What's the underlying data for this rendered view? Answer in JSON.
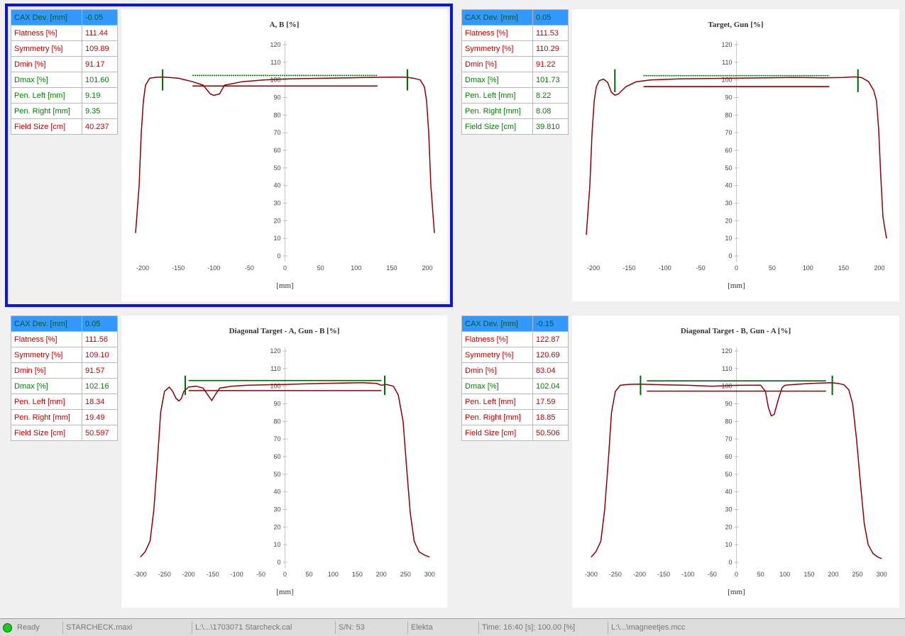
{
  "panels": [
    {
      "id": "ab",
      "selected": true,
      "stats": [
        {
          "label": "CAX Dev. [mm]",
          "value": "-0.05",
          "color": "green"
        },
        {
          "label": "Flatness [%]",
          "value": "111.44",
          "color": "red"
        },
        {
          "label": "Symmetry [%]",
          "value": "109.89",
          "color": "red"
        },
        {
          "label": "Dmin [%]",
          "value": "91.17",
          "color": "red"
        },
        {
          "label": "Dmax [%]",
          "value": "101.60",
          "color": "green"
        },
        {
          "label": "Pen. Left [mm]",
          "value": "9.19",
          "color": "green"
        },
        {
          "label": "Pen. Right [mm]",
          "value": "9.35",
          "color": "green"
        },
        {
          "label": "Field Size [cm]",
          "value": "40.237",
          "color": "red"
        }
      ]
    },
    {
      "id": "target",
      "selected": false,
      "stats": [
        {
          "label": "CAX Dev. [mm]",
          "value": "0.05",
          "color": "green"
        },
        {
          "label": "Flatness [%]",
          "value": "111.53",
          "color": "red"
        },
        {
          "label": "Symmetry [%]",
          "value": "110.29",
          "color": "red"
        },
        {
          "label": "Dmin [%]",
          "value": "91.22",
          "color": "red"
        },
        {
          "label": "Dmax [%]",
          "value": "101.73",
          "color": "green"
        },
        {
          "label": "Pen. Left [mm]",
          "value": "8.22",
          "color": "green"
        },
        {
          "label": "Pen. Right [mm]",
          "value": "8.08",
          "color": "green"
        },
        {
          "label": "Field Size [cm]",
          "value": "39.810",
          "color": "green"
        }
      ]
    },
    {
      "id": "diag1",
      "selected": false,
      "stats": [
        {
          "label": "CAX Dev. [mm]",
          "value": "0.05",
          "color": "green"
        },
        {
          "label": "Flatness [%]",
          "value": "111.56",
          "color": "red"
        },
        {
          "label": "Symmetry [%]",
          "value": "109.10",
          "color": "red"
        },
        {
          "label": "Dmin [%]",
          "value": "91.57",
          "color": "red"
        },
        {
          "label": "Dmax [%]",
          "value": "102.16",
          "color": "green"
        },
        {
          "label": "Pen. Left [mm]",
          "value": "18.34",
          "color": "red"
        },
        {
          "label": "Pen. Right [mm]",
          "value": "19.49",
          "color": "red"
        },
        {
          "label": "Field Size [cm]",
          "value": "50.597",
          "color": "red"
        }
      ]
    },
    {
      "id": "diag2",
      "selected": false,
      "stats": [
        {
          "label": "CAX Dev. [mm]",
          "value": "-0.15",
          "color": "green"
        },
        {
          "label": "Flatness [%]",
          "value": "122.87",
          "color": "red"
        },
        {
          "label": "Symmetry [%]",
          "value": "120.69",
          "color": "red"
        },
        {
          "label": "Dmin [%]",
          "value": "83.04",
          "color": "red"
        },
        {
          "label": "Dmax [%]",
          "value": "102.04",
          "color": "green"
        },
        {
          "label": "Pen. Left [mm]",
          "value": "17.59",
          "color": "red"
        },
        {
          "label": "Pen. Right [mm]",
          "value": "18.85",
          "color": "red"
        },
        {
          "label": "Field Size [cm]",
          "value": "50.506",
          "color": "red"
        }
      ]
    }
  ],
  "chart_data": [
    {
      "type": "line",
      "title": "A, B [%]",
      "xlabel": "[mm]",
      "xlim": [
        -210,
        210
      ],
      "ylim": [
        0,
        120
      ],
      "xticks": [
        "-200",
        "-150",
        "-100",
        "-50",
        "0",
        "50",
        "100",
        "150",
        "200"
      ],
      "yticks": [
        "0",
        "10",
        "20",
        "30",
        "40",
        "50",
        "60",
        "70",
        "80",
        "90",
        "100",
        "110",
        "120"
      ],
      "profile": {
        "x": [
          -210,
          -205,
          -202,
          -199,
          -196,
          -190,
          -180,
          -170,
          -150,
          -130,
          -115,
          -105,
          -100,
          -92,
          -85,
          -60,
          -30,
          0,
          30,
          60,
          90,
          120,
          150,
          170,
          180,
          190,
          196,
          199,
          202,
          205,
          210
        ],
        "y": [
          13,
          40,
          70,
          88,
          97,
          101,
          101.5,
          101.6,
          101,
          99,
          97,
          92,
          91.2,
          92,
          97,
          99,
          100,
          100.5,
          100.8,
          101,
          101.2,
          101.4,
          101.6,
          101.5,
          101,
          100,
          96,
          88,
          70,
          40,
          13
        ]
      },
      "markers_x": [
        -172,
        172
      ],
      "markers_y": [
        [
          94,
          106
        ],
        [
          94,
          106
        ]
      ],
      "lines": [
        {
          "x1": -130,
          "x2": 130,
          "y": 102.5,
          "color": "#006400",
          "dashed": true
        },
        {
          "x1": -130,
          "x2": 130,
          "y": 96.5,
          "color": "#8b0000",
          "dashed": false
        }
      ]
    },
    {
      "type": "line",
      "title": "Target, Gun [%]",
      "xlabel": "[mm]",
      "xlim": [
        -210,
        210
      ],
      "ylim": [
        0,
        120
      ],
      "xticks": [
        "-200",
        "-150",
        "-100",
        "-50",
        "0",
        "50",
        "100",
        "150",
        "200"
      ],
      "yticks": [
        "0",
        "10",
        "20",
        "30",
        "40",
        "50",
        "60",
        "70",
        "80",
        "90",
        "100",
        "110",
        "120"
      ],
      "profile": {
        "x": [
          -210,
          -205,
          -202,
          -199,
          -196,
          -192,
          -186,
          -180,
          -175,
          -170,
          -165,
          -155,
          -140,
          -120,
          -80,
          -40,
          0,
          40,
          80,
          120,
          150,
          165,
          175,
          185,
          192,
          196,
          199,
          202,
          205,
          210
        ],
        "y": [
          12,
          40,
          70,
          88,
          96,
          99.5,
          100.5,
          98.5,
          93,
          91.3,
          92,
          96,
          99,
          100,
          100.6,
          100.8,
          101,
          101.2,
          101.4,
          101.2,
          101.4,
          101.7,
          101.3,
          99,
          94,
          88,
          72,
          45,
          22,
          10
        ]
      },
      "markers_x": [
        -170,
        170
      ],
      "markers_y": [
        [
          93,
          106
        ],
        [
          93,
          106
        ]
      ],
      "lines": [
        {
          "x1": -130,
          "x2": 130,
          "y": 102.4,
          "color": "#006400",
          "dashed": true
        },
        {
          "x1": -130,
          "x2": 130,
          "y": 96.2,
          "color": "#8b0000",
          "dashed": false
        }
      ]
    },
    {
      "type": "line",
      "title": "Diagonal Target - A, Gun - B [%]",
      "xlabel": "[mm]",
      "xlim": [
        -310,
        310
      ],
      "ylim": [
        0,
        120
      ],
      "xticks": [
        "-300",
        "-250",
        "-200",
        "-150",
        "-100",
        "-50",
        "0",
        "50",
        "100",
        "150",
        "200",
        "250",
        "300"
      ],
      "yticks": [
        "0",
        "10",
        "20",
        "30",
        "40",
        "50",
        "60",
        "70",
        "80",
        "90",
        "100",
        "110",
        "120"
      ],
      "profile": {
        "x": [
          -300,
          -290,
          -280,
          -272,
          -264,
          -258,
          -250,
          -240,
          -233,
          -226,
          -220,
          -215,
          -210,
          -200,
          -185,
          -170,
          -160,
          -152,
          -145,
          -135,
          -110,
          -80,
          -40,
          0,
          40,
          80,
          120,
          160,
          190,
          200,
          210,
          225,
          235,
          245,
          252,
          260,
          268,
          278,
          290,
          300
        ],
        "y": [
          3,
          6,
          12,
          30,
          60,
          85,
          97,
          99.5,
          97,
          93,
          91.6,
          93,
          97,
          99.5,
          100,
          99,
          95,
          91.8,
          95,
          99,
          100,
          100.5,
          100.8,
          101,
          101.3,
          101.6,
          101.8,
          102,
          101.6,
          100.5,
          101,
          100,
          95,
          80,
          55,
          28,
          12,
          6,
          4,
          3
        ]
      },
      "markers_x": [
        -207,
        207
      ],
      "markers_y": [
        [
          95,
          106
        ],
        [
          95,
          106
        ]
      ],
      "lines": [
        {
          "x1": -200,
          "x2": 200,
          "y": 103.2,
          "color": "#006400",
          "dashed": false
        },
        {
          "x1": -200,
          "x2": 200,
          "y": 97.5,
          "color": "#8b0000",
          "dashed": false
        }
      ]
    },
    {
      "type": "line",
      "title": "Diagonal Target - B, Gun - A [%]",
      "xlabel": "[mm]",
      "xlim": [
        -310,
        310
      ],
      "ylim": [
        0,
        120
      ],
      "xticks": [
        "-300",
        "-250",
        "-200",
        "-150",
        "-100",
        "-50",
        "0",
        "50",
        "100",
        "150",
        "200",
        "250",
        "300"
      ],
      "yticks": [
        "0",
        "10",
        "20",
        "30",
        "40",
        "50",
        "60",
        "70",
        "80",
        "90",
        "100",
        "110",
        "120"
      ],
      "profile": {
        "x": [
          -300,
          -290,
          -280,
          -272,
          -264,
          -258,
          -250,
          -240,
          -225,
          -200,
          -150,
          -100,
          -50,
          0,
          50,
          60,
          66,
          72,
          78,
          86,
          94,
          100,
          110,
          150,
          195,
          210,
          222,
          232,
          240,
          248,
          256,
          264,
          272,
          282,
          292,
          300
        ],
        "y": [
          3,
          6,
          12,
          30,
          60,
          85,
          97,
          100.5,
          101,
          101.2,
          100.8,
          100.5,
          100,
          100.5,
          100.6,
          97,
          88,
          83.1,
          84,
          92,
          99,
          100.5,
          100.8,
          101.5,
          102,
          101.6,
          100.8,
          98,
          90,
          70,
          45,
          22,
          10,
          5,
          3,
          2
        ]
      },
      "markers_x": [
        -198,
        198
      ],
      "markers_y": [
        [
          95,
          106
        ],
        [
          95,
          106
        ]
      ],
      "lines": [
        {
          "x1": -185,
          "x2": 185,
          "y": 103,
          "color": "#006400",
          "dashed": false
        },
        {
          "x1": -185,
          "x2": 185,
          "y": 97.2,
          "color": "#8b0000",
          "dashed": false
        }
      ]
    }
  ],
  "colors": {
    "selection": "#0a14e6",
    "profile": "#8b0000",
    "marker": "#006400",
    "highlight": "#3399ff"
  },
  "statusbar": {
    "status": "Ready",
    "layout": "STARCHECK.maxi",
    "calibration": "L:\\...\\1703071 Starcheck.cal",
    "serial": "S/N: 53",
    "vendor": "Elekta",
    "time": "Time: 16:40 [s]; 100.00 [%]",
    "file": "L:\\...\\magneetjes.mcc"
  }
}
